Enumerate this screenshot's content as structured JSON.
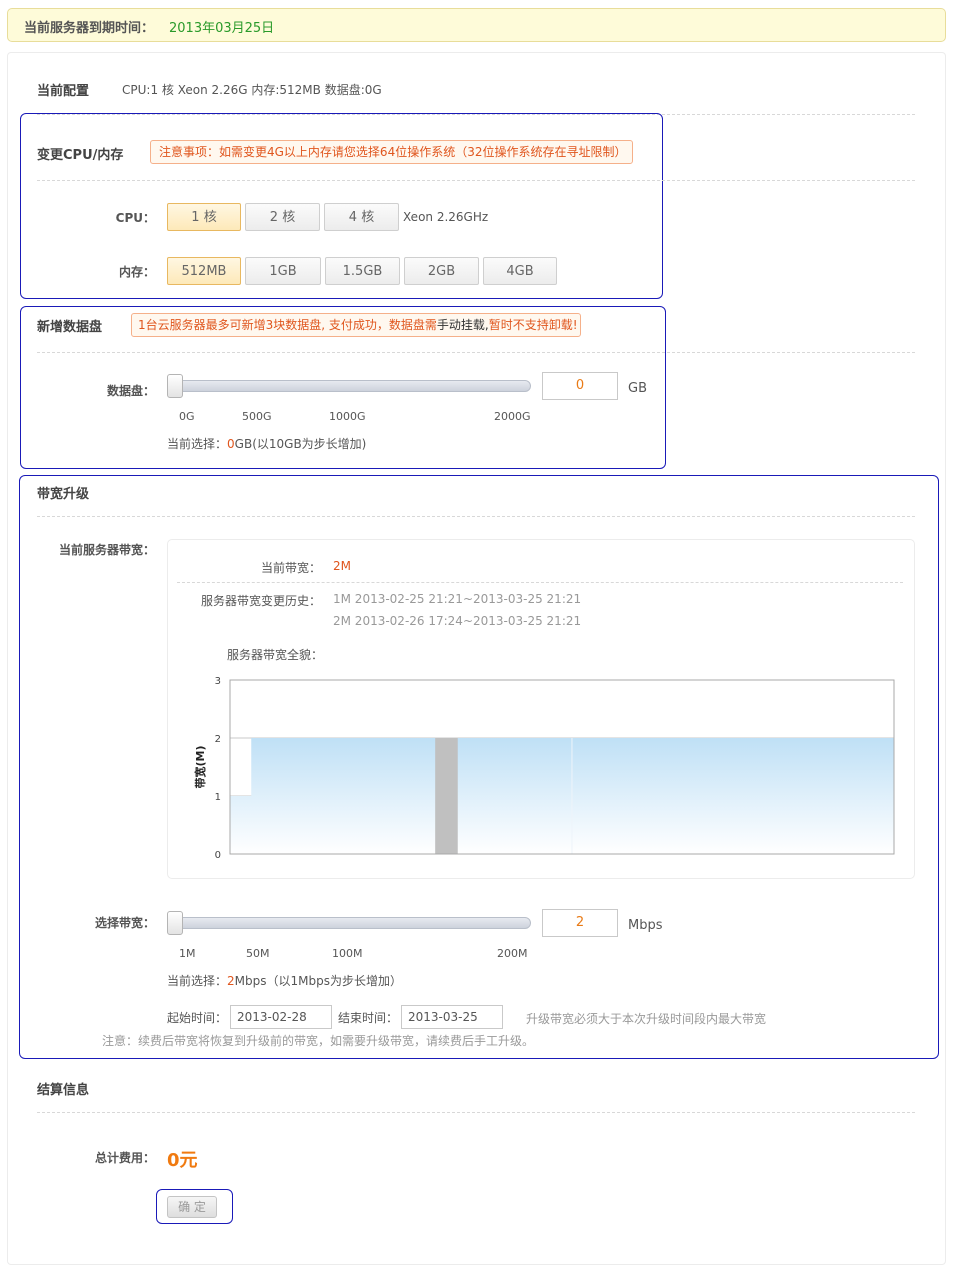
{
  "top": {
    "expiry_label": "当前服务器到期时间：",
    "expiry_value": "2013年03月25日"
  },
  "config": {
    "title": "当前配置",
    "text": "CPU:1 核 Xeon 2.26G 内存:512MB 数据盘:0G"
  },
  "cpu_mem": {
    "title": "变更CPU/内存",
    "notice": "注意事项：如需变更4G以上内存请您选择64位操作系统（32位操作系统存在寻址限制）",
    "cpu_label": "CPU：",
    "cpu_options": [
      "1 核",
      "2 核",
      "4 核"
    ],
    "cpu_selected": "1 核",
    "cpu_model": "Xeon 2.26GHz",
    "mem_label": "内存：",
    "mem_options": [
      "512MB",
      "1GB",
      "1.5GB",
      "2GB",
      "4GB"
    ],
    "mem_selected": "512MB"
  },
  "disk": {
    "title": "新增数据盘",
    "notice_orange1": "1台云服务器最多可新增3块数据盘, 支付成功，数据盘需",
    "notice_plain": "手动挂载,",
    "notice_orange2": "暂时不支持卸载!",
    "label": "数据盘：",
    "value": "0",
    "unit": "GB",
    "slider_fraction": 0,
    "ticks": [
      "0G",
      "500G",
      "1000G",
      "2000G"
    ],
    "current_prefix": "当前选择：",
    "current_value": "0",
    "current_suffix": "GB(以10GB为步长增加)"
  },
  "bandwidth": {
    "title": "带宽升级",
    "server_bw_label": "当前服务器带宽：",
    "current_label": "当前带宽：",
    "current_value": "2M",
    "history_label": "服务器带宽变更历史：",
    "history": [
      "1M 2013-02-25 21:21~2013-03-25 21:21",
      "2M 2013-02-26 17:24~2013-03-25 21:21"
    ],
    "overview_label": "服务器带宽全貌：",
    "select_label": "选择带宽：",
    "value": "2",
    "unit": "Mbps",
    "slider_fraction": 0,
    "ticks": [
      "1M",
      "50M",
      "100M",
      "200M"
    ],
    "current_prefix": "当前选择：",
    "current_select_value": "2",
    "current_suffix": "Mbps（以1Mbps为步长增加）",
    "start_label": "起始时间：",
    "start_value": "2013-02-28",
    "end_label": "结束时间：",
    "end_value": "2013-03-25",
    "hint": "升级带宽必须大于本次升级时间段内最大带宽",
    "note": "注意：续费后带宽将恢复到升级前的带宽，如需要升级带宽，请续费后手工升级。"
  },
  "chart_data": {
    "type": "area",
    "ylabel": "带宽(M)",
    "ylim": [
      0,
      3
    ],
    "yticks": [
      "0",
      "1",
      "2",
      "3"
    ],
    "x_fraction": [
      0,
      0.032,
      0.032,
      1
    ],
    "values": [
      1,
      1,
      2,
      2
    ],
    "marker_fraction": [
      0.309,
      0.343
    ],
    "fill_color": "#bfe0f6",
    "marker_color": "#c0c0c0"
  },
  "settlement": {
    "title": "结算信息",
    "total_label": "总计费用：",
    "total_value": "0元",
    "confirm": "确 定"
  }
}
